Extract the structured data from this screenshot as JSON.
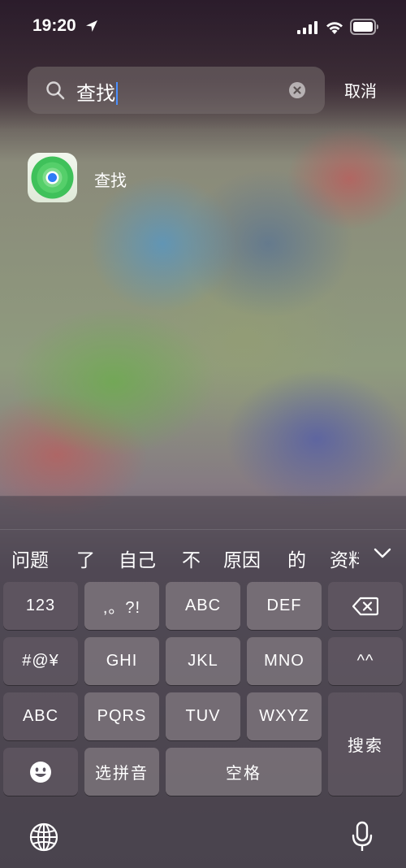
{
  "status_bar": {
    "time": "19:20",
    "icons": [
      "location-arrow-icon",
      "cellular-signal-icon",
      "wifi-icon",
      "battery-icon"
    ]
  },
  "search": {
    "query": "查找",
    "cancel_label": "取消"
  },
  "results": [
    {
      "label": "查找",
      "icon": "find-my-app-icon"
    }
  ],
  "keyboard": {
    "candidates": [
      "问题",
      "了",
      "自己",
      "不",
      "原因",
      "的",
      "资料"
    ],
    "rows": [
      [
        "123",
        ",。?!",
        "ABC",
        "DEF"
      ],
      [
        "#@¥",
        "GHI",
        "JKL",
        "MNO",
        "^^"
      ],
      [
        "ABC",
        "PQRS",
        "TUV",
        "WXYZ"
      ]
    ],
    "search_key": "搜索",
    "pinyin_key": "选拼音",
    "space_key": "空格",
    "icons": [
      "backspace-icon",
      "emoji-icon",
      "globe-icon",
      "microphone-icon",
      "chevron-down-icon"
    ]
  },
  "colors": {
    "cursor": "#4a90ff",
    "find_my_green": "#34c759",
    "find_my_blue": "#2f7cf6"
  }
}
